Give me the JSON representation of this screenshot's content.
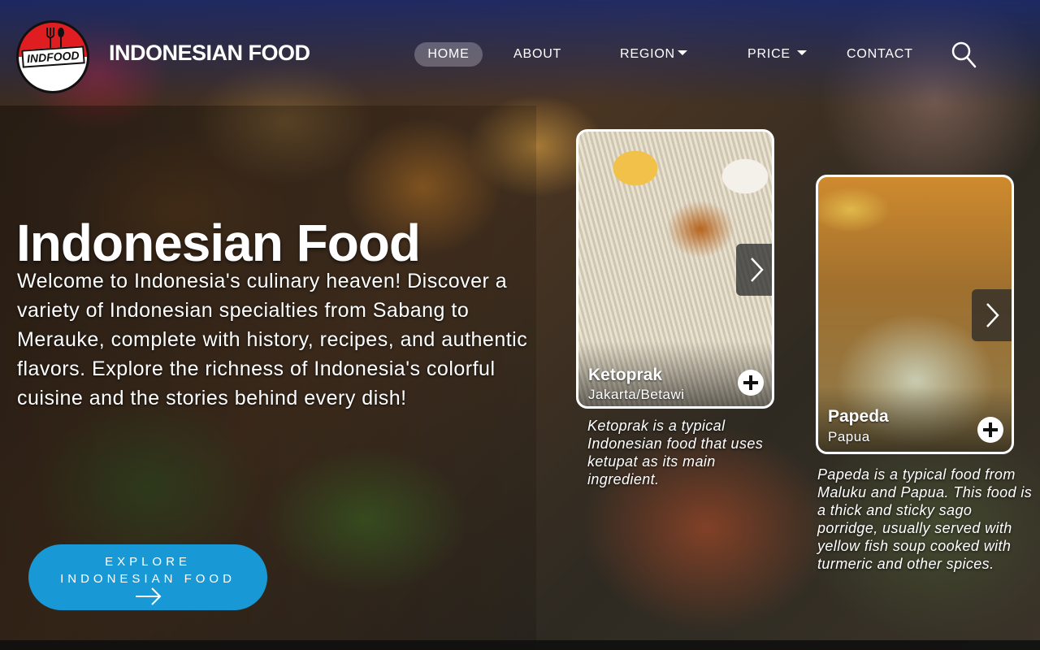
{
  "brand": {
    "logo_text": "INDFOOD",
    "name": "INDONESIAN FOOD"
  },
  "nav": {
    "home": "HOME",
    "about": "ABOUT",
    "region": "REGION",
    "price": "PRICE",
    "contact": "CONTACT",
    "active": "HOME",
    "icons": {
      "search": "search-icon",
      "dropdown": "caret-down-icon"
    }
  },
  "hero": {
    "title": "Indonesian Food",
    "text": "Welcome to Indonesia's culinary heaven! Discover a variety of Indonesian specialties from Sabang to Merauke, complete with history, recipes, and authentic flavors. Explore the richness of Indonesia's colorful cuisine and the stories behind every dish!",
    "cta_label": "EXPLORE INDONESIAN FOOD",
    "cta_icon": "arrow-right-icon"
  },
  "cards": [
    {
      "name": "Ketoprak",
      "region": "Jakarta/Betawi",
      "description": "Ketoprak is a typical Indonesian food that uses ketupat as its main ingredient."
    },
    {
      "name": "Papeda",
      "region": "Papua",
      "description": "Papeda is a typical food from Maluku and Papua. This food is a thick and sticky sago porridge, usually served with yellow fish soup cooked with turmeric and other spices."
    }
  ],
  "colors": {
    "accent": "#1899d6",
    "logo_red": "#e01e22",
    "text": "#ffffff"
  }
}
